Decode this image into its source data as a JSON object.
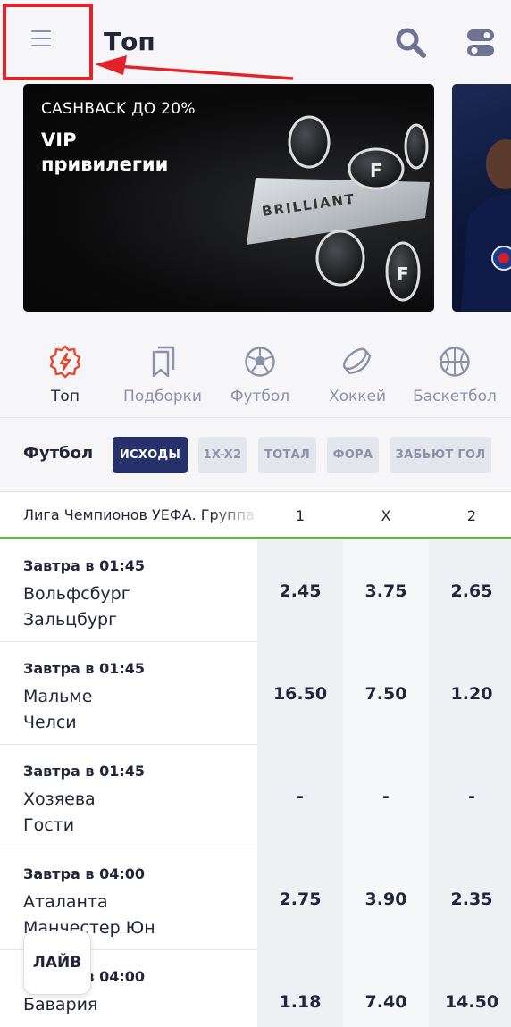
{
  "header": {
    "title": "Топ",
    "menu_icon": "hamburger-menu-icon",
    "search_icon": "search-icon",
    "settings_icon": "toggle-settings-icon",
    "highlight_color": "#e0242a"
  },
  "banner": {
    "subtitle": "CASHBACK ДО 20%",
    "title_line1": "VIP",
    "title_line2": "привилегии",
    "card_text": "BRILLIANT"
  },
  "sports": [
    {
      "label": "Топ",
      "icon": "lightning-icon",
      "active": true
    },
    {
      "label": "Подборки",
      "icon": "bookmarks-icon",
      "active": false
    },
    {
      "label": "Футбол",
      "icon": "soccer-ball-icon",
      "active": false
    },
    {
      "label": "Хоккей",
      "icon": "hockey-puck-icon",
      "active": false
    },
    {
      "label": "Баскетбол",
      "icon": "basketball-icon",
      "active": false
    }
  ],
  "markets": {
    "title": "Футбол",
    "chips": [
      "ИСХОДЫ",
      "1X-X2",
      "ТОТАЛ",
      "ФОРА",
      "ЗАБЬЮТ ГОЛ"
    ],
    "active_chip": "ИСХОДЫ"
  },
  "table": {
    "league": "Лига Чемпионов УЕФА. Группа",
    "columns": [
      "1",
      "X",
      "2"
    ]
  },
  "matches": [
    {
      "time": "Завтра в 01:45",
      "team1": "Вольфсбург",
      "team2": "Зальцбург",
      "odds": [
        "2.45",
        "3.75",
        "2.65"
      ]
    },
    {
      "time": "Завтра в 01:45",
      "team1": "Мальме",
      "team2": "Челси",
      "odds": [
        "16.50",
        "7.50",
        "1.20"
      ]
    },
    {
      "time": "Завтра в 01:45",
      "team1": "Хозяева",
      "team2": "Гости",
      "odds": [
        "-",
        "-",
        "-"
      ]
    },
    {
      "time": "Завтра в 04:00",
      "team1": "Аталанта",
      "team2": "Манчестер Юн",
      "odds": [
        "2.75",
        "3.90",
        "2.35"
      ]
    },
    {
      "time": "Завтра в 04:00",
      "team1": "Бавария",
      "team2": "",
      "odds": [
        "1.18",
        "7.40",
        "14.50"
      ]
    }
  ],
  "live_button": {
    "label": "ЛАЙВ"
  },
  "colors": {
    "accent_navy": "#26306a",
    "accent_red": "#e8452c",
    "divider_green": "#6ab04c"
  }
}
